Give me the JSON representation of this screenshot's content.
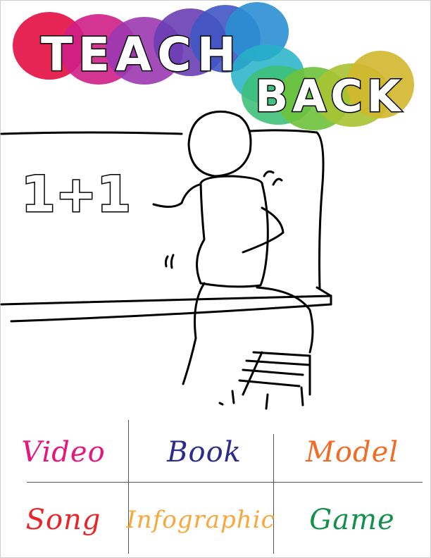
{
  "title": {
    "line1": "TEACH",
    "line2": "BACK"
  },
  "board": {
    "equation": "1+1"
  },
  "options": [
    {
      "label": "Video",
      "color": "#e6157f"
    },
    {
      "label": "Book",
      "color": "#2b2c8c"
    },
    {
      "label": "Model",
      "color": "#f26b25"
    },
    {
      "label": "Song",
      "color": "#e8262a"
    },
    {
      "label": "Infographic",
      "color": "#f9a73b"
    },
    {
      "label": "Game",
      "color": "#13914b"
    }
  ],
  "colors": {
    "rainbow": [
      "#e6194b",
      "#cf1f87",
      "#9b38b0",
      "#6a3eb4",
      "#3f57c3",
      "#2a8fd3",
      "#24b1c8",
      "#3ec07a",
      "#6ec23b",
      "#a8c233",
      "#d2b72e"
    ]
  }
}
